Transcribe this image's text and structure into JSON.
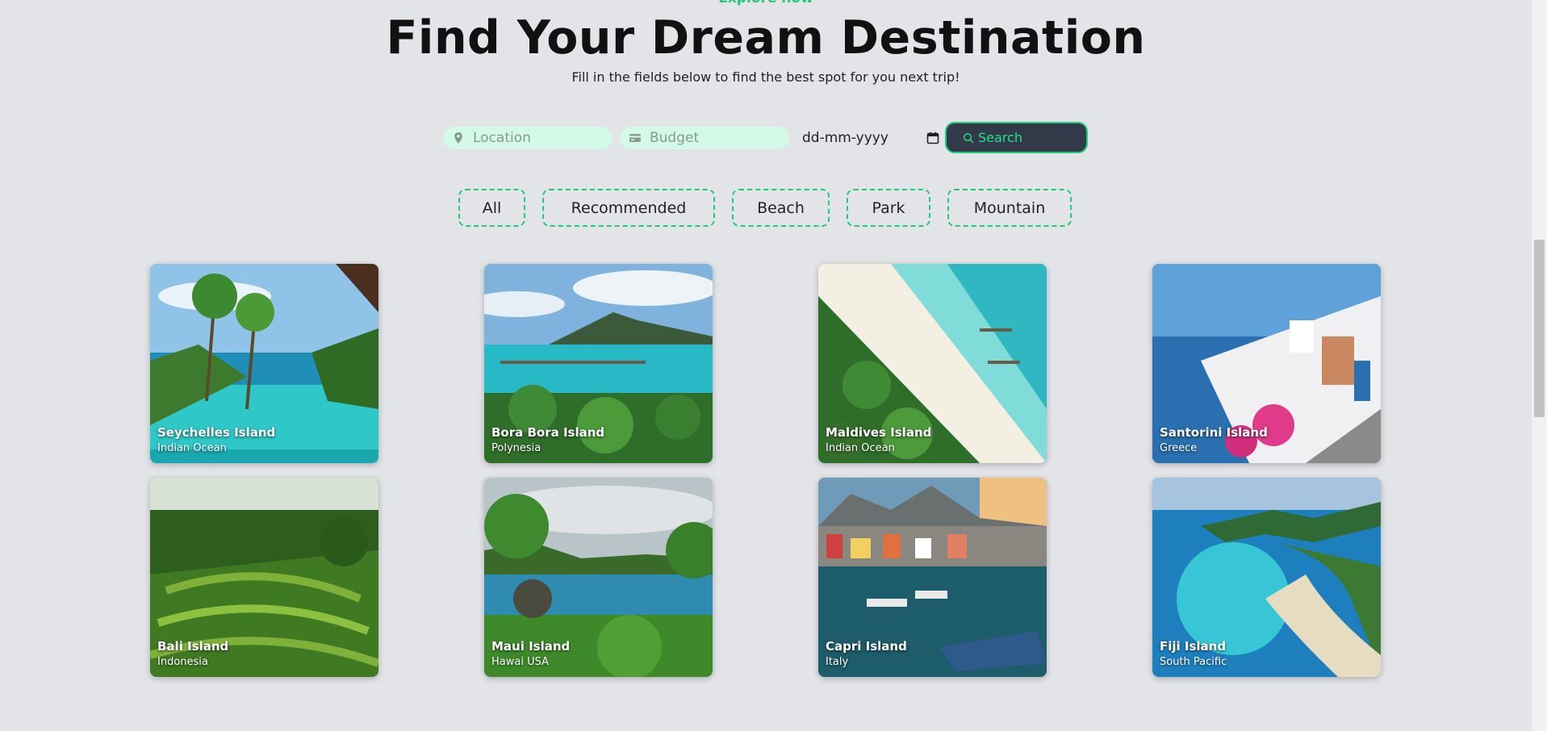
{
  "header": {
    "top_link": "Explore now",
    "title": "Find Your Dream Destination",
    "subtitle": "Fill in the fields below to find the best spot for you next trip!"
  },
  "search": {
    "location_placeholder": "Location",
    "budget_placeholder": "Budget",
    "date_value": "dd-mm-yyyy",
    "search_label": "Search"
  },
  "filters": [
    "All",
    "Recommended",
    "Beach",
    "Park",
    "Mountain"
  ],
  "destinations": [
    {
      "name": "Seychelles Island",
      "location": "Indian Ocean"
    },
    {
      "name": "Bora Bora Island",
      "location": "Polynesia"
    },
    {
      "name": "Maldives Island",
      "location": "Indian Ocean"
    },
    {
      "name": "Santorini Island",
      "location": "Greece"
    },
    {
      "name": "Bali Island",
      "location": "Indonesia"
    },
    {
      "name": "Maui Island",
      "location": "Hawai USA"
    },
    {
      "name": "Capri Island",
      "location": "Italy"
    },
    {
      "name": "Fiji Island",
      "location": "South Pacific"
    }
  ],
  "colors": {
    "accent": "#22c97a",
    "field_bg": "#d3fae7",
    "button_bg": "#323a4a",
    "page_bg": "#e2e4e8"
  }
}
